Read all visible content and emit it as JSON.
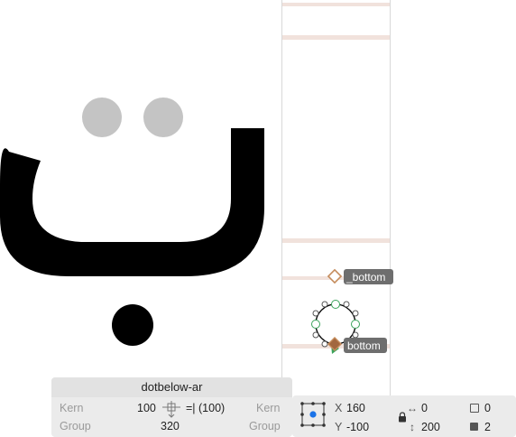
{
  "app": {
    "accent_color": "#6e6e6e",
    "metric_line_color": "#f1e2dc",
    "anchor_color": "#c58c5c"
  },
  "canvas": {
    "glyph_char": "ٮ",
    "anchors": [
      {
        "label": "_bottom",
        "icon": "hollow-diamond-anchor-icon"
      },
      {
        "label": "bottom",
        "icon": "filled-diamond-anchor-icon"
      }
    ]
  },
  "glyph_panel": {
    "name": "dotbelow-ar",
    "kern_left_label": "Kern",
    "kern_left_value": "100",
    "kern_right_value": "=| (100)",
    "kern_right_label": "Kern",
    "group_left_label": "Group",
    "group_value": "320",
    "group_right_label": "Group"
  },
  "position_panel": {
    "x_label": "X",
    "x_value": "160",
    "y_label": "Y",
    "y_value": "-100",
    "width_value": "0",
    "height_value": "200",
    "width_icon": "horizontal-arrows-icon",
    "height_icon": "vertical-arrows-icon",
    "lock_icon": "lock-icon",
    "open_count": "0",
    "closed_count": "2"
  }
}
